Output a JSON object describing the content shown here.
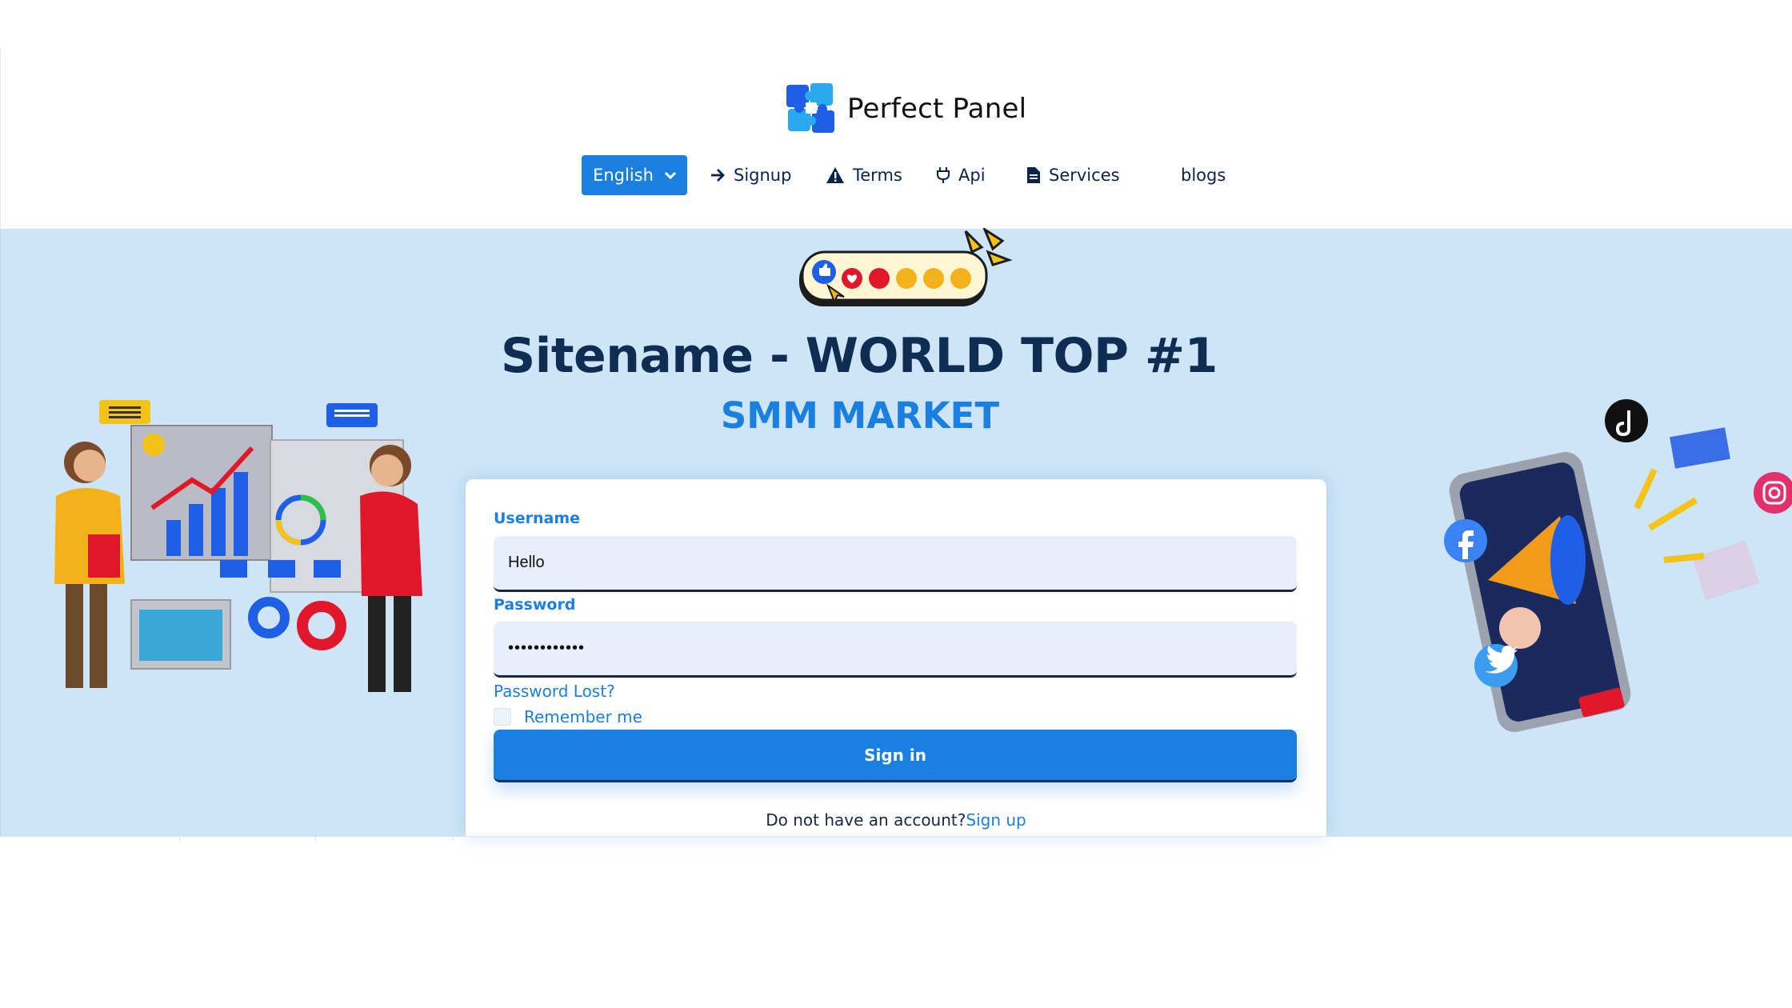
{
  "brand": {
    "name": "Perfect Panel"
  },
  "nav": {
    "language": "English",
    "signup": "Signup",
    "terms": "Terms",
    "api": "Api",
    "services": "Services",
    "blogs": "blogs"
  },
  "hero": {
    "title": "Sitename - WORLD TOP #1",
    "subtitle": "SMM MARKET"
  },
  "form": {
    "username_label": "Username",
    "username_value": "Hello",
    "password_label": "Password",
    "password_value": "••••••••••••",
    "password_lost": "Password Lost?",
    "remember_me": "Remember me",
    "signin_label": "Sign in",
    "no_account_text": "Do not have an account?",
    "signup_link": "Sign up"
  },
  "colors": {
    "accent": "#1b7fe0",
    "hero_bg": "#cde5f6",
    "title": "#0f2d52",
    "field_bg": "#e8eefc"
  },
  "icons": [
    "chevron-down-icon",
    "arrow-right-icon",
    "warning-icon",
    "plug-icon",
    "file-icon",
    "facebook-icon",
    "twitter-icon",
    "tiktok-icon",
    "instagram-icon"
  ]
}
